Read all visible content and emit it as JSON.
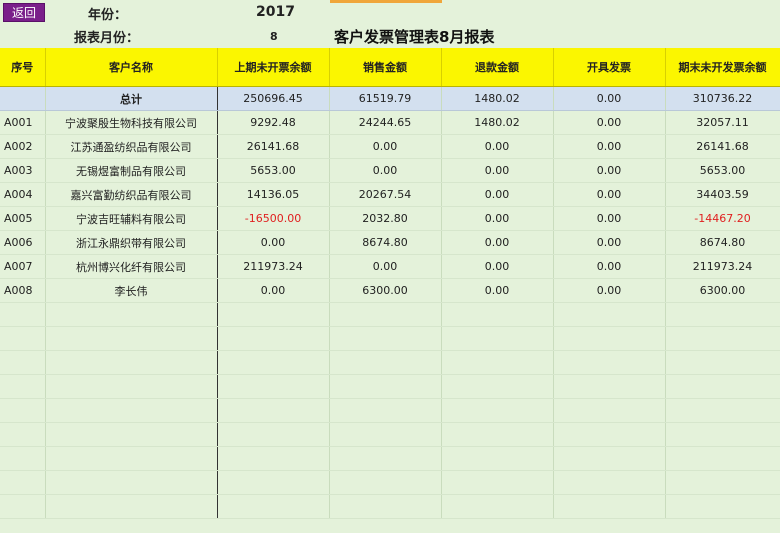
{
  "header": {
    "back_label": "返回",
    "year_label": "年份：",
    "year_value": "2017",
    "month_label": "报表月份：",
    "month_value": "8",
    "title": "客户发票管理表8月报表"
  },
  "table": {
    "columns": [
      "序号",
      "客户名称",
      "上期未开票余额",
      "销售金额",
      "退款金额",
      "开具发票",
      "期末未开发票余额"
    ],
    "total": {
      "label": "总计",
      "values": [
        "250696.45",
        "61519.79",
        "1480.02",
        "0.00",
        "310736.22"
      ]
    },
    "rows": [
      {
        "id": "A001",
        "name": "宁波聚殷生物科技有限公司",
        "prev": "9292.48",
        "sales": "24244.65",
        "refund": "1480.02",
        "invoiced": "0.00",
        "end": "32057.11",
        "prev_neg": false,
        "end_neg": false
      },
      {
        "id": "A002",
        "name": "江苏通盈纺织品有限公司",
        "prev": "26141.68",
        "sales": "0.00",
        "refund": "0.00",
        "invoiced": "0.00",
        "end": "26141.68",
        "prev_neg": false,
        "end_neg": false
      },
      {
        "id": "A003",
        "name": "无锡煜富制品有限公司",
        "prev": "5653.00",
        "sales": "0.00",
        "refund": "0.00",
        "invoiced": "0.00",
        "end": "5653.00",
        "prev_neg": false,
        "end_neg": false
      },
      {
        "id": "A004",
        "name": "嘉兴富勤纺织品有限公司",
        "prev": "14136.05",
        "sales": "20267.54",
        "refund": "0.00",
        "invoiced": "0.00",
        "end": "34403.59",
        "prev_neg": false,
        "end_neg": false
      },
      {
        "id": "A005",
        "name": "宁波吉旺辅料有限公司",
        "prev": "-16500.00",
        "sales": "2032.80",
        "refund": "0.00",
        "invoiced": "0.00",
        "end": "-14467.20",
        "prev_neg": true,
        "end_neg": true
      },
      {
        "id": "A006",
        "name": "浙江永鼎织带有限公司",
        "prev": "0.00",
        "sales": "8674.80",
        "refund": "0.00",
        "invoiced": "0.00",
        "end": "8674.80",
        "prev_neg": false,
        "end_neg": false
      },
      {
        "id": "A007",
        "name": "杭州博兴化纤有限公司",
        "prev": "211973.24",
        "sales": "0.00",
        "refund": "0.00",
        "invoiced": "0.00",
        "end": "211973.24",
        "prev_neg": false,
        "end_neg": false
      },
      {
        "id": "A008",
        "name": "李长伟",
        "prev": "0.00",
        "sales": "6300.00",
        "refund": "0.00",
        "invoiced": "0.00",
        "end": "6300.00",
        "prev_neg": false,
        "end_neg": false
      }
    ]
  },
  "colors": {
    "back_button": "#7a1f8a",
    "header_row": "#fbf600",
    "total_row": "#d3e0ef",
    "background": "#e4f2da",
    "negative": "#e02020"
  }
}
